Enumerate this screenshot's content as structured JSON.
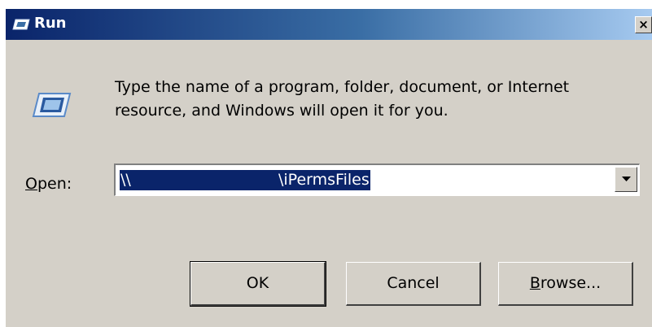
{
  "window": {
    "title": "Run",
    "close_glyph": "×",
    "icon": "run-icon"
  },
  "dialog": {
    "description": "Type the name of a program, folder, document, or Internet resource, and Windows will open it for you.",
    "open_label_accel": "O",
    "open_label_rest": "pen:",
    "open_value": "\\\\                              \\iPermsFiles"
  },
  "buttons": {
    "ok": "OK",
    "cancel": "Cancel",
    "browse_accel": "B",
    "browse_rest": "rowse..."
  },
  "colors": {
    "titlebar_start": "#0a246a",
    "titlebar_end": "#a6caf0",
    "face": "#d4d0c8",
    "selection": "#0a246a"
  }
}
